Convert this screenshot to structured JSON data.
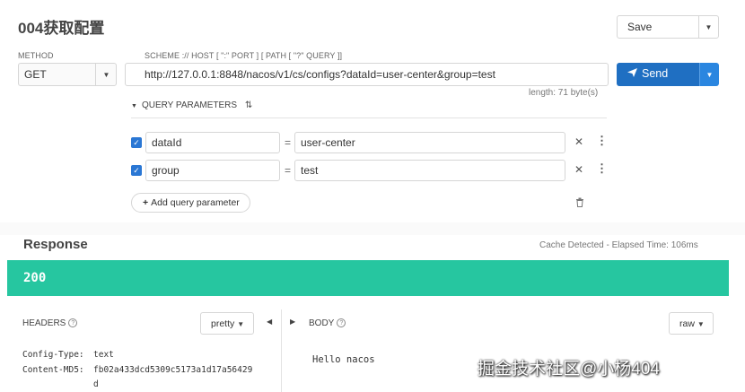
{
  "request": {
    "title": "004获取配置",
    "save_label": "Save",
    "method_label": "METHOD",
    "method_value": "GET",
    "url_label": "SCHEME :// HOST [ \":\" PORT ] [ PATH [ \"?\" QUERY ]]",
    "url_value": "http://127.0.0.1:8848/nacos/v1/cs/configs?dataId=user-center&group=test",
    "send_label": "Send",
    "length_info": "length: 71 byte(s)",
    "query_header": "QUERY PARAMETERS",
    "params": [
      {
        "key": "dataId",
        "eq": "=",
        "value": "user-center",
        "checked": true
      },
      {
        "key": "group",
        "eq": "=",
        "value": "test",
        "checked": true
      }
    ],
    "add_param_label": "Add query parameter"
  },
  "response": {
    "title": "Response",
    "cache_info": "Cache Detected - Elapsed Time: 106ms",
    "status_code": "200",
    "status_color": "#26c6a0",
    "headers_label": "HEADERS",
    "headers_format": "pretty",
    "body_label": "BODY",
    "body_format": "raw",
    "headers": [
      {
        "name": "Config-Type:",
        "value": "text"
      },
      {
        "name": "Content-MD5:",
        "value": "fb02a433dcd5309c5173a1d17a56429"
      },
      {
        "name": "",
        "value": "d"
      }
    ],
    "body": "Hello nacos"
  },
  "watermark": "掘金技术社区@小杨404",
  "colors": {
    "send_button": "#1f6fc2",
    "checkbox": "#2a77d4"
  }
}
